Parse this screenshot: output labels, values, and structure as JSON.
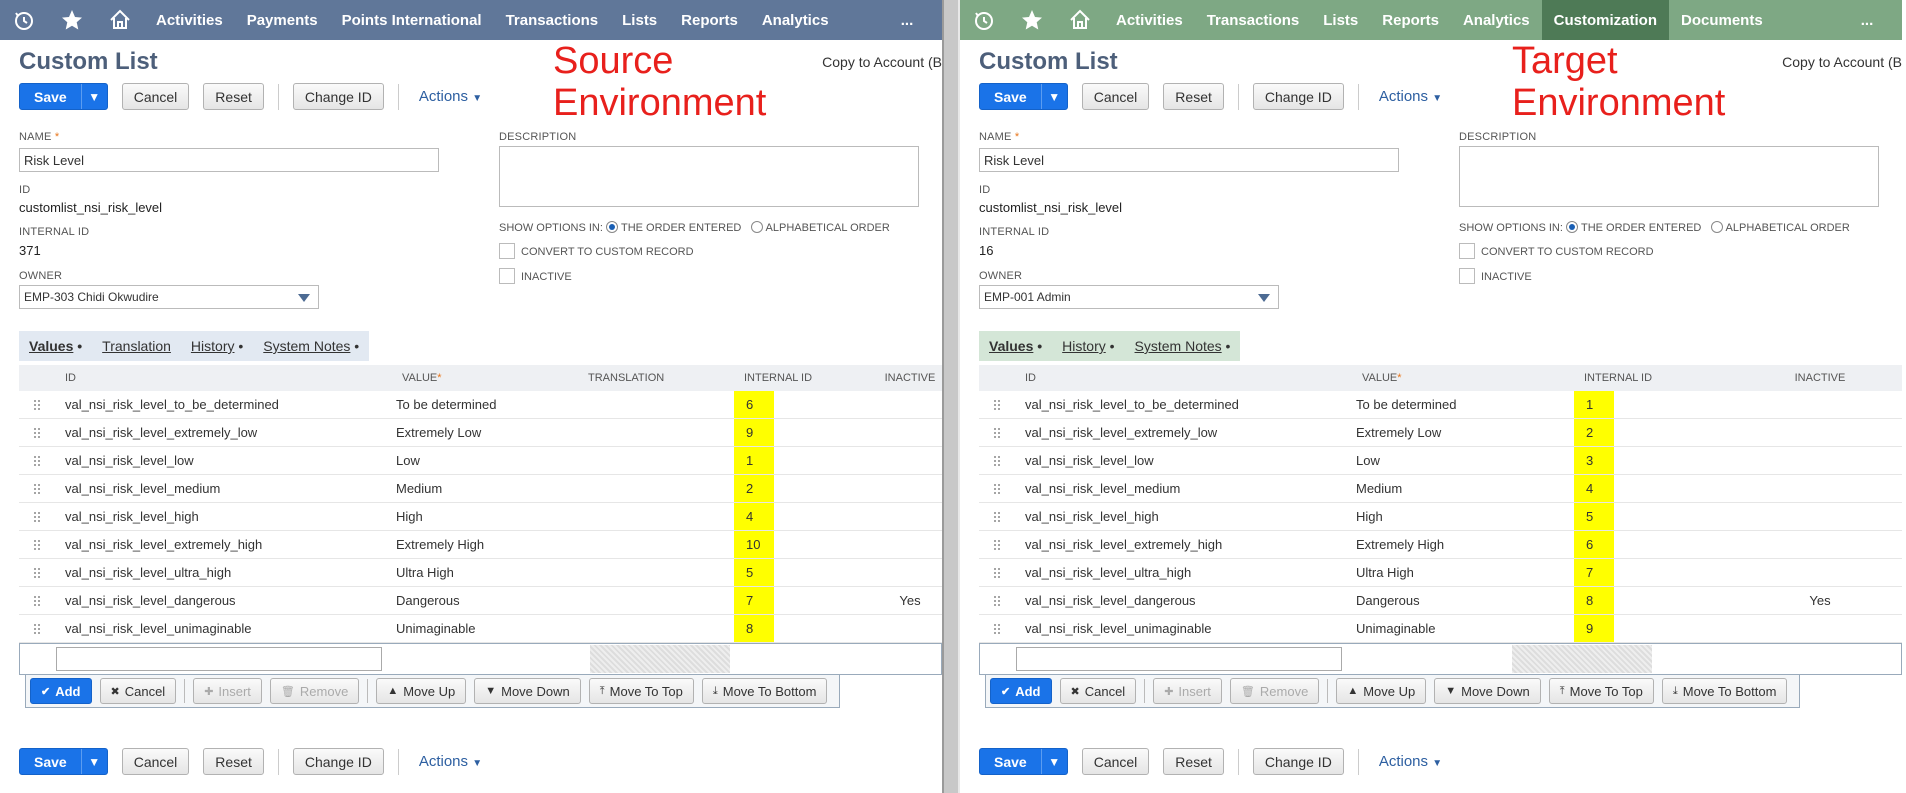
{
  "left": {
    "nav": [
      "Activities",
      "Payments",
      "Points International",
      "Transactions",
      "Lists",
      "Reports",
      "Analytics"
    ],
    "nav_active": "",
    "env_label_line1": "Source",
    "env_label_line2": "Environment",
    "nav_color": "#607799",
    "name": "Risk Level",
    "id_value": "customlist_nsi_risk_level",
    "internal_id": "371",
    "owner": "EMP-303 Chidi Okwudire",
    "subtabs": [
      "Values",
      "Translation",
      "History",
      "System Notes"
    ],
    "columns": [
      "ID",
      "VALUE",
      "TRANSLATION",
      "INTERNAL ID",
      "INACTIVE"
    ],
    "rows": [
      {
        "id": "val_nsi_risk_level_to_be_determined",
        "value": "To be determined",
        "iid": "6",
        "inactive": ""
      },
      {
        "id": "val_nsi_risk_level_extremely_low",
        "value": "Extremely Low",
        "iid": "9",
        "inactive": ""
      },
      {
        "id": "val_nsi_risk_level_low",
        "value": "Low",
        "iid": "1",
        "inactive": ""
      },
      {
        "id": "val_nsi_risk_level_medium",
        "value": "Medium",
        "iid": "2",
        "inactive": ""
      },
      {
        "id": "val_nsi_risk_level_high",
        "value": "High",
        "iid": "4",
        "inactive": ""
      },
      {
        "id": "val_nsi_risk_level_extremely_high",
        "value": "Extremely High",
        "iid": "10",
        "inactive": ""
      },
      {
        "id": "val_nsi_risk_level_ultra_high",
        "value": "Ultra High",
        "iid": "5",
        "inactive": ""
      },
      {
        "id": "val_nsi_risk_level_dangerous",
        "value": "Dangerous",
        "iid": "7",
        "inactive": "Yes"
      },
      {
        "id": "val_nsi_risk_level_unimaginable",
        "value": "Unimaginable",
        "iid": "8",
        "inactive": ""
      }
    ]
  },
  "right": {
    "nav": [
      "Activities",
      "Transactions",
      "Lists",
      "Reports",
      "Analytics",
      "Customization",
      "Documents"
    ],
    "nav_active": "Customization",
    "env_label_line1": "Target",
    "env_label_line2": "Environment",
    "nav_color": "#7ea884",
    "name": "Risk Level",
    "id_value": "customlist_nsi_risk_level",
    "internal_id": "16",
    "owner": "EMP-001 Admin",
    "subtabs": [
      "Values",
      "History",
      "System Notes"
    ],
    "columns": [
      "ID",
      "VALUE",
      "INTERNAL ID",
      "INACTIVE"
    ],
    "rows": [
      {
        "id": "val_nsi_risk_level_to_be_determined",
        "value": "To be determined",
        "iid": "1",
        "inactive": ""
      },
      {
        "id": "val_nsi_risk_level_extremely_low",
        "value": "Extremely Low",
        "iid": "2",
        "inactive": ""
      },
      {
        "id": "val_nsi_risk_level_low",
        "value": "Low",
        "iid": "3",
        "inactive": ""
      },
      {
        "id": "val_nsi_risk_level_medium",
        "value": "Medium",
        "iid": "4",
        "inactive": ""
      },
      {
        "id": "val_nsi_risk_level_high",
        "value": "High",
        "iid": "5",
        "inactive": ""
      },
      {
        "id": "val_nsi_risk_level_extremely_high",
        "value": "Extremely High",
        "iid": "6",
        "inactive": ""
      },
      {
        "id": "val_nsi_risk_level_ultra_high",
        "value": "Ultra High",
        "iid": "7",
        "inactive": ""
      },
      {
        "id": "val_nsi_risk_level_dangerous",
        "value": "Dangerous",
        "iid": "8",
        "inactive": "Yes"
      },
      {
        "id": "val_nsi_risk_level_unimaginable",
        "value": "Unimaginable",
        "iid": "9",
        "inactive": ""
      }
    ]
  },
  "common": {
    "nav_more": "...",
    "page_title": "Custom List",
    "copy_link": "Copy to Account (B",
    "buttons": {
      "save": "Save",
      "cancel": "Cancel",
      "reset": "Reset",
      "change_id": "Change ID",
      "actions": "Actions"
    },
    "labels": {
      "name": "NAME",
      "required": "*",
      "id": "ID",
      "internal_id": "INTERNAL ID",
      "owner": "OWNER",
      "description": "DESCRIPTION",
      "show_options_in": "SHOW OPTIONS IN:",
      "order_entered": "THE ORDER ENTERED",
      "alphabetical": "ALPHABETICAL ORDER",
      "convert": "CONVERT TO CUSTOM RECORD",
      "inactive": "INACTIVE"
    },
    "toolbar": {
      "add": "Add",
      "cancel": "Cancel",
      "insert": "Insert",
      "remove": "Remove",
      "move_up": "Move Up",
      "move_down": "Move Down",
      "move_top": "Move To Top",
      "move_bottom": "Move To Bottom"
    },
    "highlight_color": "#ffff00",
    "accent_color": "#1a73e8",
    "env_label_color": "#e8201c"
  }
}
